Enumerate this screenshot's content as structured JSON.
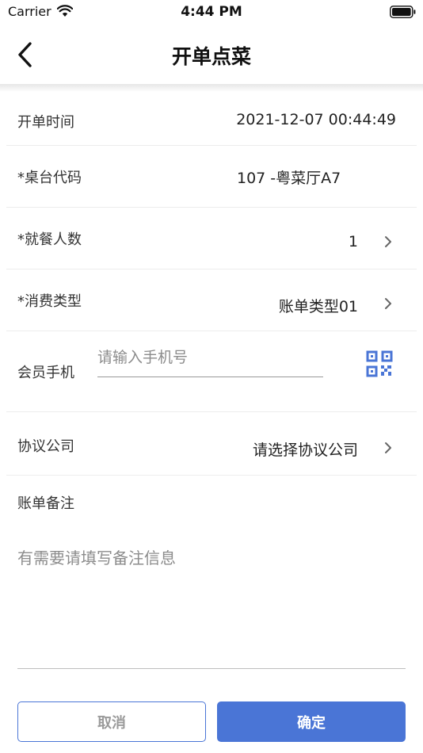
{
  "status_bar": {
    "carrier": "Carrier",
    "time": "4:44 PM"
  },
  "nav": {
    "title": "开单点菜",
    "back_icon": "chevron-left-icon"
  },
  "form": {
    "open_time": {
      "label": "开单时间",
      "value": "2021-12-07 00:44:49"
    },
    "table_code": {
      "label": "*桌台代码",
      "value": "107  -粤菜厅A7"
    },
    "guests": {
      "label": "*就餐人数",
      "value": "1"
    },
    "consume_type": {
      "label": "*消费类型",
      "value": "账单类型01"
    },
    "member_phone": {
      "label": "会员手机",
      "placeholder": "请输入手机号",
      "value": "",
      "scan_icon": "qr-code-icon"
    },
    "company": {
      "label": "协议公司",
      "value": "请选择协议公司"
    },
    "remark": {
      "label": "账单备注",
      "placeholder": "有需要请填写备注信息",
      "value": ""
    }
  },
  "buttons": {
    "cancel": "取消",
    "confirm": "确定"
  },
  "colors": {
    "accent": "#4a75d6",
    "divider": "#ededed",
    "placeholder": "#8c8c8c"
  }
}
